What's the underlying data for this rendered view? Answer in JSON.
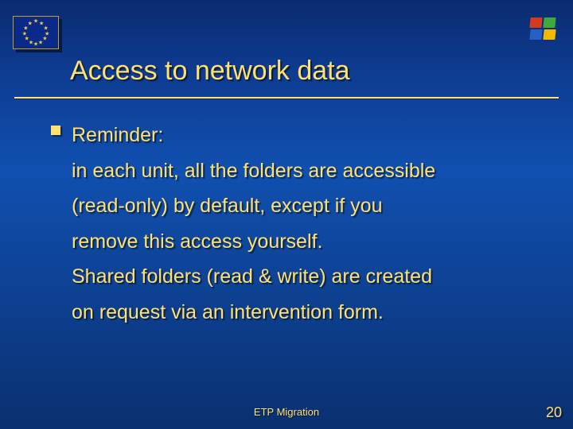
{
  "title": "Access to network data",
  "bullet": {
    "lead": "Reminder:",
    "line1": "in each unit, all the folders are accessible",
    "line2": "(read-only) by default, except if you",
    "line3": "remove this access yourself.",
    "line4": "Shared folders (read & write) are created",
    "line5": "on request via an intervention form."
  },
  "footer": {
    "center": "ETP Migration",
    "page": "20"
  },
  "icons": {
    "left": "eu-flag",
    "right": "windows-logo"
  }
}
